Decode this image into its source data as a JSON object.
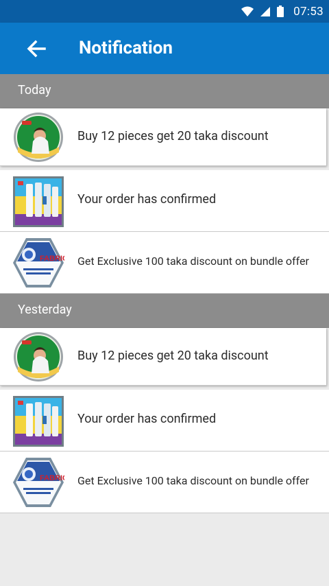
{
  "status_bar": {
    "time": "07:53"
  },
  "app_bar": {
    "title": "Notification"
  },
  "sections": [
    {
      "header": "Today",
      "items": [
        {
          "text": "Buy 12 pieces get 20 taka discount",
          "thumb": "taaza-tea-icon"
        },
        {
          "text": "Your order has confirmed",
          "thumb": "products-box-icon"
        },
        {
          "text": "Get Exclusive 100 taka discount on bundle offer",
          "thumb": "fabric-bundle-icon",
          "thumb_text": "FABRIC BUNDLE"
        }
      ]
    },
    {
      "header": "Yesterday",
      "items": [
        {
          "text": "Buy 12 pieces get 20 taka discount",
          "thumb": "taaza-tea-icon"
        },
        {
          "text": "Your order has confirmed",
          "thumb": "products-box-icon"
        },
        {
          "text": "Get Exclusive 100 taka discount on bundle offer",
          "thumb": "fabric-bundle-icon",
          "thumb_text": "FABRIC BUNDLE"
        }
      ]
    }
  ],
  "thumbs": {
    "taaza_brand": "Taaza"
  },
  "colors": {
    "status_bar": "#0a5da3",
    "app_bar": "#0b79c9",
    "section_header": "#8c8c8c",
    "background": "#ebebeb"
  }
}
